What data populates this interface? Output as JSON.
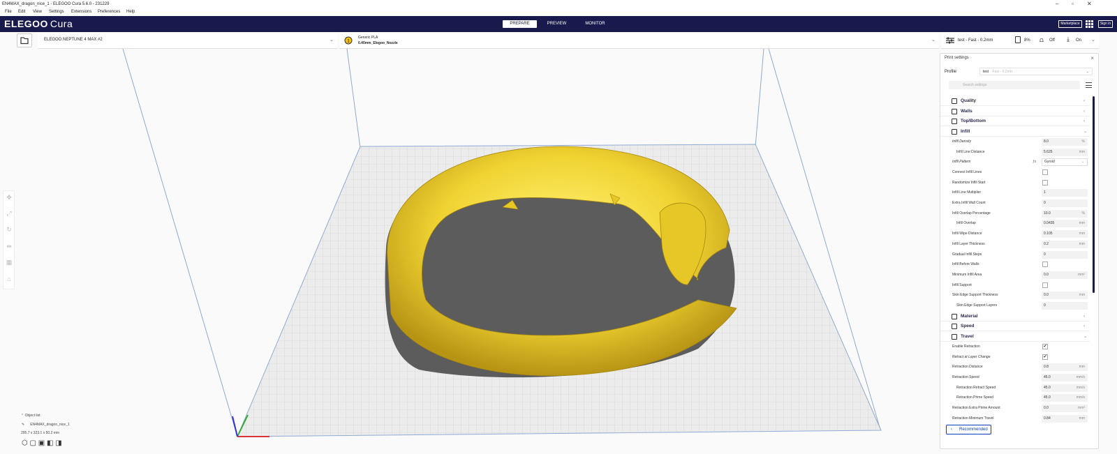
{
  "window": {
    "title": "EN4MAX_dragon_nice_1 - ELEGOO Cura 5.6.0 - 231229"
  },
  "menu": [
    "File",
    "Edit",
    "View",
    "Settings",
    "Extensions",
    "Preferences",
    "Help"
  ],
  "header": {
    "logo": "ELEGOO",
    "logo_sub": "Cura",
    "stages": [
      {
        "label": "PREPARE",
        "active": true
      },
      {
        "label": "PREVIEW",
        "active": false
      },
      {
        "label": "MONITOR",
        "active": false
      }
    ],
    "marketplace": "Marketplace",
    "signin": "Sign in"
  },
  "toolbar": {
    "printer": "ELEGOO NEPTUNE 4 MAX #2",
    "material": "Generic PLA",
    "nozzle": "0.40mm_Elegoo_Nozzle",
    "profile_summary": "test - Fast - 0.2mm",
    "infill": "8%",
    "support": "Off",
    "adhesion": "On"
  },
  "object": {
    "list_label": "Object list",
    "name": "EN4MAX_dragon_nice_1",
    "dims": "295.7 x 323.1 x 50.2 mm"
  },
  "panel": {
    "title": "Print settings",
    "profile_label": "Profile",
    "profile_name": "test",
    "profile_detail": "Fast - 0.2mm",
    "search_placeholder": "Search settings",
    "categories_top": [
      "Quality",
      "Walls",
      "Top/Bottom",
      "Infill"
    ],
    "infill_settings": [
      {
        "label": "Infill Density",
        "value": "8.0",
        "unit": "%",
        "italic": true
      },
      {
        "label": "Infill Line Distance",
        "value": "5.625",
        "unit": "mm",
        "indent": true
      },
      {
        "label": "Infill Pattern",
        "value": "Gyroid",
        "kind": "dropdown",
        "italic": true
      },
      {
        "label": "Connect Infill Lines",
        "kind": "checkbox",
        "checked": false
      },
      {
        "label": "Randomize Infill Start",
        "kind": "checkbox",
        "checked": false
      },
      {
        "label": "Infill Line Multiplier",
        "value": "1",
        "unit": ""
      },
      {
        "label": "Extra Infill Wall Count",
        "value": "0",
        "unit": ""
      },
      {
        "label": "Infill Overlap Percentage",
        "value": "10.0",
        "unit": "%"
      },
      {
        "label": "Infill Overlap",
        "value": "0.0435",
        "unit": "mm",
        "indent": true
      },
      {
        "label": "Infill Wipe Distance",
        "value": "0.105",
        "unit": "mm"
      },
      {
        "label": "Infill Layer Thickness",
        "value": "0.2",
        "unit": "mm"
      },
      {
        "label": "Gradual Infill Steps",
        "value": "0",
        "unit": ""
      },
      {
        "label": "Infill Before Walls",
        "kind": "checkbox",
        "checked": false
      },
      {
        "label": "Minimum Infill Area",
        "value": "0.0",
        "unit": "mm²"
      },
      {
        "label": "Infill Support",
        "kind": "checkbox",
        "checked": false
      },
      {
        "label": "Skin Edge Support Thickness",
        "value": "0.0",
        "unit": "mm"
      },
      {
        "label": "Skin Edge Support Layers",
        "value": "0",
        "unit": "",
        "indent": true
      }
    ],
    "categories_mid": [
      "Material",
      "Speed",
      "Travel"
    ],
    "travel_settings": [
      {
        "label": "Enable Retraction",
        "kind": "checkbox",
        "checked": true
      },
      {
        "label": "Retract at Layer Change",
        "kind": "checkbox",
        "checked": true,
        "italic": true
      },
      {
        "label": "Retraction Distance",
        "value": "0.8",
        "unit": "mm"
      },
      {
        "label": "Retraction Speed",
        "value": "45.0",
        "unit": "mm/s"
      },
      {
        "label": "Retraction Retract Speed",
        "value": "45.0",
        "unit": "mm/s",
        "indent": true
      },
      {
        "label": "Retraction Prime Speed",
        "value": "45.0",
        "unit": "mm/s",
        "indent": true
      },
      {
        "label": "Retraction Extra Prime Amount",
        "value": "0.0",
        "unit": "mm³"
      },
      {
        "label": "Retraction Minimum Travel",
        "value": "0.84",
        "unit": "mm"
      }
    ],
    "recommended": "Recommended"
  },
  "colors": {
    "header": "#181a4d",
    "model": "#f5de3c",
    "model_shade": "#c9a91c",
    "plate": "#e6e6e6",
    "grid": "#c8c8c8",
    "accent": "#0a3fbf"
  }
}
